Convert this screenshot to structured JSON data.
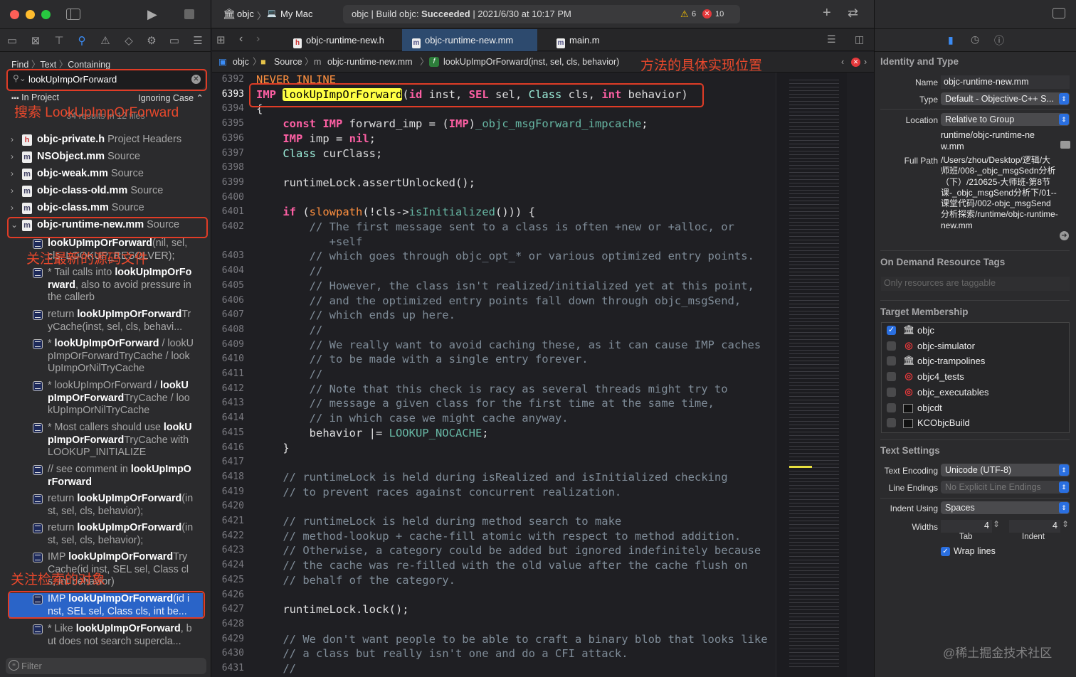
{
  "toolbar": {
    "scheme": "objc",
    "destination": "My Mac",
    "status_prefix": "objc | Build objc: ",
    "status_result": "Succeeded",
    "status_time": " | 2021/6/30 at 10:17 PM",
    "warnings": "6",
    "errors": "10"
  },
  "tabs": [
    {
      "label": "objc-runtime-new.h",
      "icon": "h",
      "active": false
    },
    {
      "label": "objc-runtime-new.mm",
      "icon": "m",
      "active": true
    },
    {
      "label": "main.m",
      "icon": "m",
      "active": false
    }
  ],
  "jumpbar": {
    "project": "objc",
    "group": "Source",
    "file": "objc-runtime-new.mm",
    "symbol": "lookUpImpOrForward(inst, sel, cls, behavior)"
  },
  "find": {
    "breadcrumb": [
      "Find",
      "Text",
      "Containing"
    ],
    "query": "lookUpImpOrForward",
    "scope": "In Project",
    "case": "Ignoring Case",
    "summary": "34 results in 12 files",
    "filter_placeholder": "Filter"
  },
  "files": [
    {
      "name": "objc-private.h",
      "group": "Project Headers",
      "icon": "h",
      "expanded": false
    },
    {
      "name": "NSObject.mm",
      "group": "Source",
      "icon": "m",
      "expanded": false
    },
    {
      "name": "objc-weak.mm",
      "group": "Source",
      "icon": "m",
      "expanded": false
    },
    {
      "name": "objc-class-old.mm",
      "group": "Source",
      "icon": "m",
      "expanded": false
    },
    {
      "name": "objc-class.mm",
      "group": "Source",
      "icon": "m",
      "expanded": false
    },
    {
      "name": "objc-runtime-new.mm",
      "group": "Source",
      "icon": "m",
      "expanded": true
    }
  ],
  "results": [
    {
      "segs": [
        [
          "lookUpImpOrForward",
          1
        ],
        [
          "(nil, sel, cls, LOOKUP_RESOLVER);",
          0
        ]
      ]
    },
    {
      "segs": [
        [
          "* Tail calls into ",
          0
        ],
        [
          "lookUpImpOrForward",
          1
        ],
        [
          ", also to avoid pressure in the callerb",
          0
        ]
      ]
    },
    {
      "segs": [
        [
          "return ",
          0
        ],
        [
          "lookUpImpOrForward",
          1
        ],
        [
          "TryCache(inst, sel, cls, behavi...",
          0
        ]
      ]
    },
    {
      "segs": [
        [
          "* ",
          0
        ],
        [
          "lookUpImpOrForward",
          1
        ],
        [
          " / lookUpImpOrForwardTryCache / lookUpImpOrNilTryCache",
          0
        ]
      ]
    },
    {
      "segs": [
        [
          "* lookUpImpOrForward / ",
          0
        ],
        [
          "lookUpImpOrForward",
          1
        ],
        [
          "TryCache / lookUpImpOrNilTryCache",
          0
        ]
      ]
    },
    {
      "segs": [
        [
          "* Most callers should use ",
          0
        ],
        [
          "lookUpImpOrForward",
          1
        ],
        [
          "TryCache with LOOKUP_INITIALIZE",
          0
        ]
      ]
    },
    {
      "segs": [
        [
          "// see comment in ",
          0
        ],
        [
          "lookUpImpOrForward",
          1
        ]
      ]
    },
    {
      "segs": [
        [
          "return ",
          0
        ],
        [
          "lookUpImpOrForward",
          1
        ],
        [
          "(inst, sel, cls, behavior);",
          0
        ]
      ]
    },
    {
      "segs": [
        [
          "return ",
          0
        ],
        [
          "lookUpImpOrForward",
          1
        ],
        [
          "(inst, sel, cls, behavior);",
          0
        ]
      ]
    },
    {
      "segs": [
        [
          "IMP ",
          0
        ],
        [
          "lookUpImpOrForward",
          1
        ],
        [
          "TryCache(id inst, SEL sel, Class cls, int behavior)",
          0
        ]
      ]
    },
    {
      "segs": [
        [
          "IMP ",
          0
        ],
        [
          "lookUpImpOrForward",
          1
        ],
        [
          "(id inst, SEL sel, Class cls, int be...",
          0
        ]
      ],
      "selected": true
    },
    {
      "segs": [
        [
          "* Like ",
          0
        ],
        [
          "lookUpImpOrForward",
          1
        ],
        [
          ", but does not search supercla...",
          0
        ]
      ]
    }
  ],
  "annotations": {
    "search": "搜索 LookUpImpOrForward",
    "latest_file": "关注最新的源码文件",
    "target": "关注检索的对象",
    "impl": "方法的具体实现位置"
  },
  "code": [
    {
      "n": "6392",
      "t": [
        [
          "mac",
          "NEVER INLINE"
        ]
      ]
    },
    {
      "n": "6393",
      "cur": true,
      "t": [
        [
          "kw",
          "IMP"
        ],
        [
          "",
          " "
        ],
        [
          "hl",
          "lookUpImpOrForward"
        ],
        [
          "",
          "("
        ],
        [
          "kw",
          "id"
        ],
        [
          "",
          " inst, "
        ],
        [
          "kw",
          "SEL"
        ],
        [
          "",
          " sel, "
        ],
        [
          "ty",
          "Class"
        ],
        [
          "",
          " cls, "
        ],
        [
          "kw",
          "int"
        ],
        [
          "",
          " behavior)"
        ]
      ]
    },
    {
      "n": "6394",
      "t": [
        [
          "",
          "{"
        ]
      ]
    },
    {
      "n": "6395",
      "t": [
        [
          "",
          "    "
        ],
        [
          "kw",
          "const"
        ],
        [
          "",
          " "
        ],
        [
          "kw",
          "IMP"
        ],
        [
          "",
          " forward_imp = ("
        ],
        [
          "kw",
          "IMP"
        ],
        [
          "",
          ")"
        ],
        [
          "fn",
          "_objc_msgForward_impcache"
        ],
        [
          "",
          ";"
        ]
      ]
    },
    {
      "n": "6396",
      "t": [
        [
          "",
          "    "
        ],
        [
          "kw",
          "IMP"
        ],
        [
          "",
          " imp = "
        ],
        [
          "kw",
          "nil"
        ],
        [
          "",
          ";"
        ]
      ]
    },
    {
      "n": "6397",
      "t": [
        [
          "",
          "    "
        ],
        [
          "ty",
          "Class"
        ],
        [
          "",
          " curClass;"
        ]
      ]
    },
    {
      "n": "6398",
      "t": []
    },
    {
      "n": "6399",
      "t": [
        [
          "",
          "    runtimeLock.assertUnlocked();"
        ]
      ]
    },
    {
      "n": "6400",
      "t": []
    },
    {
      "n": "6401",
      "t": [
        [
          "",
          "    "
        ],
        [
          "kw",
          "if"
        ],
        [
          "",
          " ("
        ],
        [
          "mac",
          "slowpath"
        ],
        [
          "",
          "(!cls->"
        ],
        [
          "fn",
          "isInitialized"
        ],
        [
          "",
          "())) {"
        ]
      ]
    },
    {
      "n": "6402",
      "t": [
        [
          "cm",
          "        // The first message sent to a class is often +new or +alloc, or"
        ]
      ]
    },
    {
      "n": "",
      "t": [
        [
          "cm",
          "           +self"
        ]
      ]
    },
    {
      "n": "6403",
      "t": [
        [
          "cm",
          "        // which goes through objc_opt_* or various optimized entry points."
        ]
      ]
    },
    {
      "n": "6404",
      "t": [
        [
          "cm",
          "        //"
        ]
      ]
    },
    {
      "n": "6405",
      "t": [
        [
          "cm",
          "        // However, the class isn't realized/initialized yet at this point,"
        ]
      ]
    },
    {
      "n": "6406",
      "t": [
        [
          "cm",
          "        // and the optimized entry points fall down through objc_msgSend,"
        ]
      ]
    },
    {
      "n": "6407",
      "t": [
        [
          "cm",
          "        // which ends up here."
        ]
      ]
    },
    {
      "n": "6408",
      "t": [
        [
          "cm",
          "        //"
        ]
      ]
    },
    {
      "n": "6409",
      "t": [
        [
          "cm",
          "        // We really want to avoid caching these, as it can cause IMP caches"
        ]
      ]
    },
    {
      "n": "6410",
      "t": [
        [
          "cm",
          "        // to be made with a single entry forever."
        ]
      ]
    },
    {
      "n": "6411",
      "t": [
        [
          "cm",
          "        //"
        ]
      ]
    },
    {
      "n": "6412",
      "t": [
        [
          "cm",
          "        // Note that this check is racy as several threads might try to"
        ]
      ]
    },
    {
      "n": "6413",
      "t": [
        [
          "cm",
          "        // message a given class for the first time at the same time,"
        ]
      ]
    },
    {
      "n": "6414",
      "t": [
        [
          "cm",
          "        // in which case we might cache anyway."
        ]
      ]
    },
    {
      "n": "6415",
      "t": [
        [
          "",
          "        behavior |= "
        ],
        [
          "fn",
          "LOOKUP_NOCACHE"
        ],
        [
          "",
          ";"
        ]
      ]
    },
    {
      "n": "6416",
      "t": [
        [
          "",
          "    }"
        ]
      ]
    },
    {
      "n": "6417",
      "t": []
    },
    {
      "n": "6418",
      "t": [
        [
          "cm",
          "    // runtimeLock is held during isRealized and isInitialized checking"
        ]
      ]
    },
    {
      "n": "6419",
      "t": [
        [
          "cm",
          "    // to prevent races against concurrent realization."
        ]
      ]
    },
    {
      "n": "6420",
      "t": []
    },
    {
      "n": "6421",
      "t": [
        [
          "cm",
          "    // runtimeLock is held during method search to make"
        ]
      ]
    },
    {
      "n": "6422",
      "t": [
        [
          "cm",
          "    // method-lookup + cache-fill atomic with respect to method addition."
        ]
      ]
    },
    {
      "n": "6423",
      "t": [
        [
          "cm",
          "    // Otherwise, a category could be added but ignored indefinitely because"
        ]
      ]
    },
    {
      "n": "6424",
      "t": [
        [
          "cm",
          "    // the cache was re-filled with the old value after the cache flush on"
        ]
      ]
    },
    {
      "n": "6425",
      "t": [
        [
          "cm",
          "    // behalf of the category."
        ]
      ]
    },
    {
      "n": "6426",
      "t": []
    },
    {
      "n": "6427",
      "t": [
        [
          "",
          "    runtimeLock.lock();"
        ]
      ]
    },
    {
      "n": "6428",
      "t": []
    },
    {
      "n": "6429",
      "t": [
        [
          "cm",
          "    // We don't want people to be able to craft a binary blob that looks like"
        ]
      ]
    },
    {
      "n": "6430",
      "t": [
        [
          "cm",
          "    // a class but really isn't one and do a CFI attack."
        ]
      ]
    },
    {
      "n": "6431",
      "t": [
        [
          "cm",
          "    //"
        ]
      ]
    }
  ],
  "inspector": {
    "identity_title": "Identity and Type",
    "name_label": "Name",
    "name_value": "objc-runtime-new.mm",
    "type_label": "Type",
    "type_value": "Default - Objective-C++ S...",
    "location_label": "Location",
    "location_value": "Relative to Group",
    "relative_path": "runtime/objc-runtime-new.mm",
    "full_path_label": "Full Path",
    "full_path": "/Users/zhou/Desktop/逻辑/大师班/008-_objc_msgSedn分析（下）/210625-大师班-第8节课-_objc_msgSend分析下/01--课堂代码/002-objc_msgSend分析探索/runtime/objc-runtime-new.mm",
    "odr_title": "On Demand Resource Tags",
    "odr_placeholder": "Only resources are taggable",
    "tm_title": "Target Membership",
    "targets": [
      {
        "name": "objc",
        "checked": true,
        "icon": "library"
      },
      {
        "name": "objc-simulator",
        "checked": false,
        "icon": "target"
      },
      {
        "name": "objc-trampolines",
        "checked": false,
        "icon": "library"
      },
      {
        "name": "objc4_tests",
        "checked": false,
        "icon": "target"
      },
      {
        "name": "objc_executables",
        "checked": false,
        "icon": "target"
      },
      {
        "name": "objcdt",
        "checked": false,
        "icon": "terminal"
      },
      {
        "name": "KCObjcBuild",
        "checked": false,
        "icon": "terminal"
      }
    ],
    "ts_title": "Text Settings",
    "encoding_label": "Text Encoding",
    "encoding_value": "Unicode (UTF-8)",
    "endings_label": "Line Endings",
    "endings_value": "No Explicit Line Endings",
    "indent_label": "Indent Using",
    "indent_value": "Spaces",
    "widths_label": "Widths",
    "tab_width": "4",
    "indent_width": "4",
    "tab_label": "Tab",
    "indent_sub_label": "Indent",
    "wrap_label": "Wrap lines",
    "wrap_checked": true
  },
  "watermark": "@稀土掘金技术社区",
  "colors": {
    "accent": "#2a6fe0",
    "selection": "#2a64c8",
    "annotation": "#e8482c",
    "keyword": "#fc5fa3",
    "comment": "#7f8c98",
    "search_highlight": "#ffff44"
  }
}
